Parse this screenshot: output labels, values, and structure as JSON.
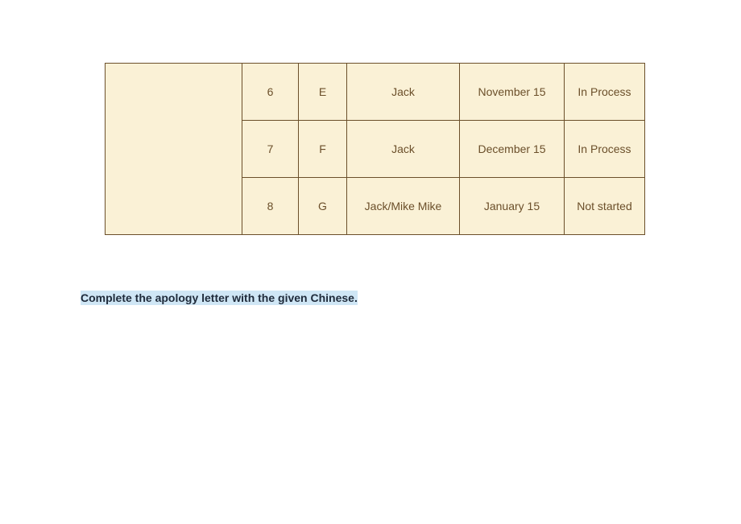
{
  "table": {
    "rows": [
      {
        "num": "6",
        "code": "E",
        "person": "Jack",
        "date": "November 15",
        "status": "In Process"
      },
      {
        "num": "7",
        "code": "F",
        "person": "Jack",
        "date": "December 15",
        "status": "In Process"
      },
      {
        "num": "8",
        "code": "G",
        "person": "Jack/Mike Mike",
        "date": "January 15",
        "status": "Not started"
      }
    ]
  },
  "instruction": "Complete the apology letter with the given Chinese."
}
